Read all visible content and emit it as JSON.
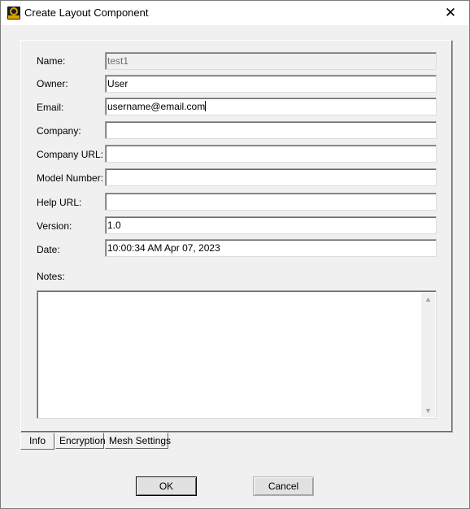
{
  "window": {
    "title": "Create Layout Component",
    "close_glyph": "✕",
    "app_icon": "app-logo-icon"
  },
  "fields": {
    "name": {
      "label": "Name:",
      "value": "test1"
    },
    "owner": {
      "label": "Owner:",
      "value": "User"
    },
    "email": {
      "label": "Email:",
      "value": "username@email.com"
    },
    "company": {
      "label": "Company:",
      "value": ""
    },
    "company_url": {
      "label": "Company URL:",
      "value": ""
    },
    "model_number": {
      "label": "Model Number:",
      "value": ""
    },
    "help_url": {
      "label": "Help URL:",
      "value": ""
    },
    "version": {
      "label": "Version:",
      "value": "1.0"
    },
    "date": {
      "label": "Date:",
      "value": "10:00:34 AM  Apr 07, 2023"
    },
    "notes": {
      "label": "Notes:",
      "value": ""
    }
  },
  "tabs": {
    "info": "Info",
    "encryption": "Encryption",
    "mesh_settings": "Mesh Settings",
    "active": "Info"
  },
  "buttons": {
    "ok": "OK",
    "cancel": "Cancel"
  },
  "scrollbar": {
    "up_glyph": "▲",
    "down_glyph": "▼"
  }
}
